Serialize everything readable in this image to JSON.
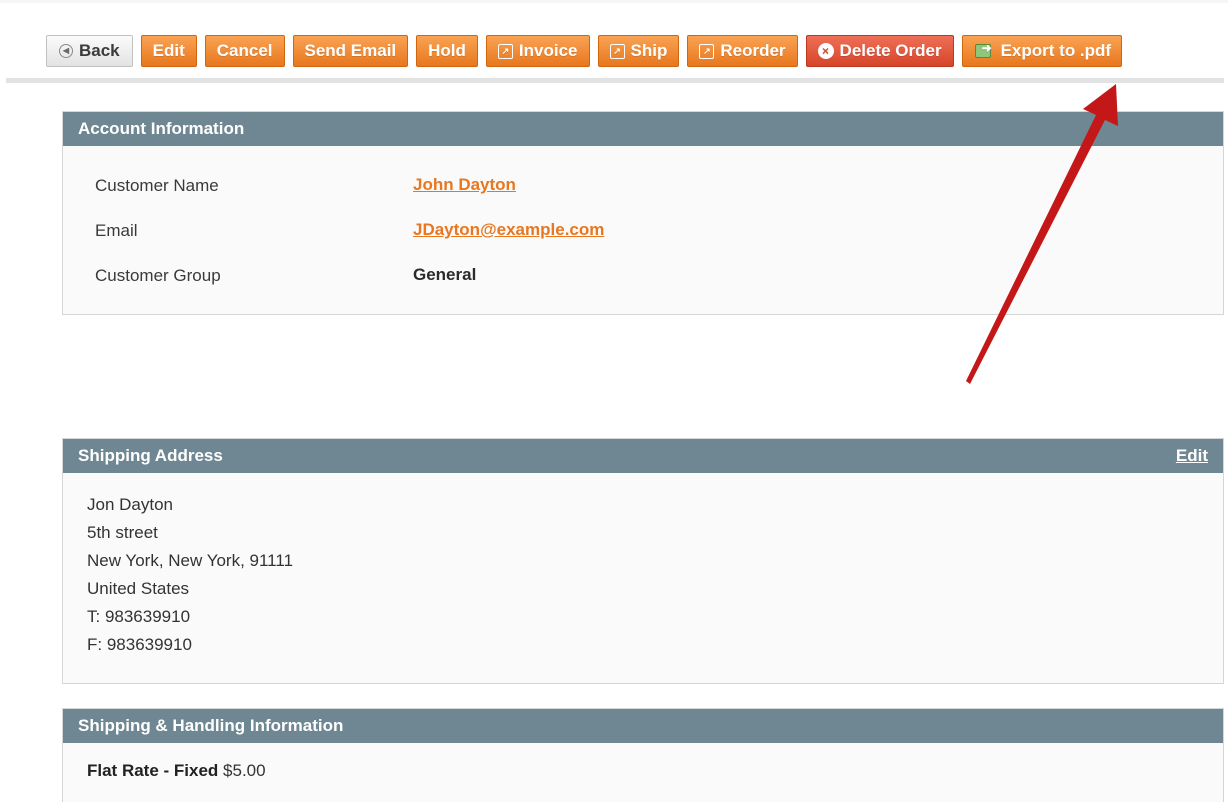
{
  "toolbar": {
    "back_label": "Back",
    "edit_label": "Edit",
    "cancel_label": "Cancel",
    "send_email_label": "Send Email",
    "hold_label": "Hold",
    "invoice_label": "Invoice",
    "ship_label": "Ship",
    "reorder_label": "Reorder",
    "delete_order_label": "Delete Order",
    "export_pdf_label": "Export to .pdf"
  },
  "account": {
    "title": "Account Information",
    "customer_name_label": "Customer Name",
    "customer_name_value": "John Dayton",
    "email_label": "Email",
    "email_value": "JDayton@example.com",
    "group_label": "Customer Group",
    "group_value": "General"
  },
  "shipping_address": {
    "title": "Shipping Address",
    "edit_label": "Edit",
    "lines": [
      "Jon Dayton",
      "5th street",
      "New York, New York, 91111",
      "United States",
      "T: 983639910",
      "F: 983639910"
    ]
  },
  "shipping_handling": {
    "title": "Shipping & Handling Information",
    "method": "Flat Rate - Fixed",
    "price": "$5.00"
  },
  "colors": {
    "button_orange": "#e8771f",
    "button_danger": "#d6452a",
    "section_header": "#6f8792",
    "link_orange": "#e8771f",
    "annotation_arrow": "#c41818"
  },
  "icons": {
    "back": "back-circle-icon",
    "invoice": "document-icon",
    "ship": "document-icon",
    "reorder": "document-icon",
    "delete": "close-circle-icon",
    "export": "export-sheet-icon"
  }
}
